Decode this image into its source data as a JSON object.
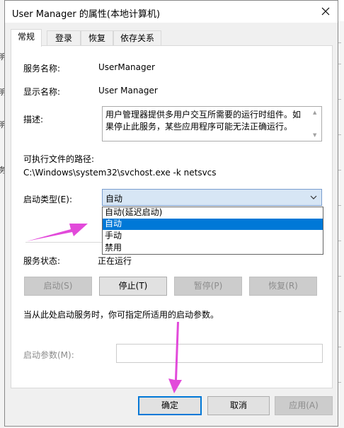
{
  "window": {
    "title": "User Manager 的属性(本地计算机)"
  },
  "tabs": [
    {
      "label": "常规",
      "active": true
    },
    {
      "label": "登录",
      "active": false
    },
    {
      "label": "恢复",
      "active": false
    },
    {
      "label": "依存关系",
      "active": false
    }
  ],
  "general": {
    "service_name_label": "服务名称:",
    "service_name_value": "UserManager",
    "display_name_label": "显示名称:",
    "display_name_value": "User Manager",
    "description_label": "描述:",
    "description_value": "用户管理器提供多用户交互所需要的运行时组件。如果停止此服务，某些应用程序可能无法正确运行。",
    "path_label": "可执行文件的路径:",
    "path_value": "C:\\Windows\\system32\\svchost.exe -k netsvcs",
    "startup_type_label": "启动类型(E):",
    "startup_type_value": "自动",
    "startup_options": [
      "自动(延迟启动)",
      "自动",
      "手动",
      "禁用"
    ],
    "startup_selected_index": 1,
    "status_label": "服务状态:",
    "status_value": "正在运行",
    "start_button": "启动(S)",
    "stop_button": "停止(T)",
    "pause_button": "暂停(P)",
    "resume_button": "恢复(R)",
    "hint": "当从此处启动服务时，你可指定所适用的启动参数。",
    "params_label": "启动参数(M):",
    "params_value": ""
  },
  "footer": {
    "ok": "确定",
    "cancel": "取消",
    "apply": "应用(A)"
  },
  "colors": {
    "accent": "#0078d7",
    "annotation_arrow": "#e040d8"
  },
  "background_fragments": [
    "明",
    "明",
    "明",
    "务"
  ]
}
